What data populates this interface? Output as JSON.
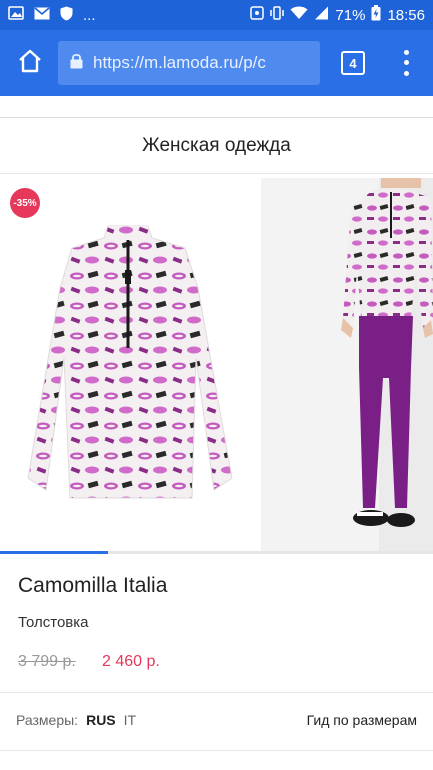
{
  "status_bar": {
    "dots": "...",
    "battery_percent": "71%",
    "time": "18:56"
  },
  "browser": {
    "url": "https://m.lamoda.ru/p/c",
    "tab_count": "4"
  },
  "page": {
    "category_title": "Женская одежда",
    "discount_badge": "-35%",
    "gallery_progress": 0.25,
    "brand": "Camomilla Italia",
    "product_type": "Толстовка",
    "old_price": "3 799 р.",
    "new_price": "2 460 р.",
    "sizes_label": "Размеры:",
    "size_systems": [
      "RUS",
      "IT"
    ],
    "size_guide_label": "Гид по размерам"
  },
  "colors": {
    "status_bar": "#1f63d8",
    "toolbar": "#2a6fe6",
    "accent_price": "#e5385a",
    "pants": "#7a1f86"
  }
}
